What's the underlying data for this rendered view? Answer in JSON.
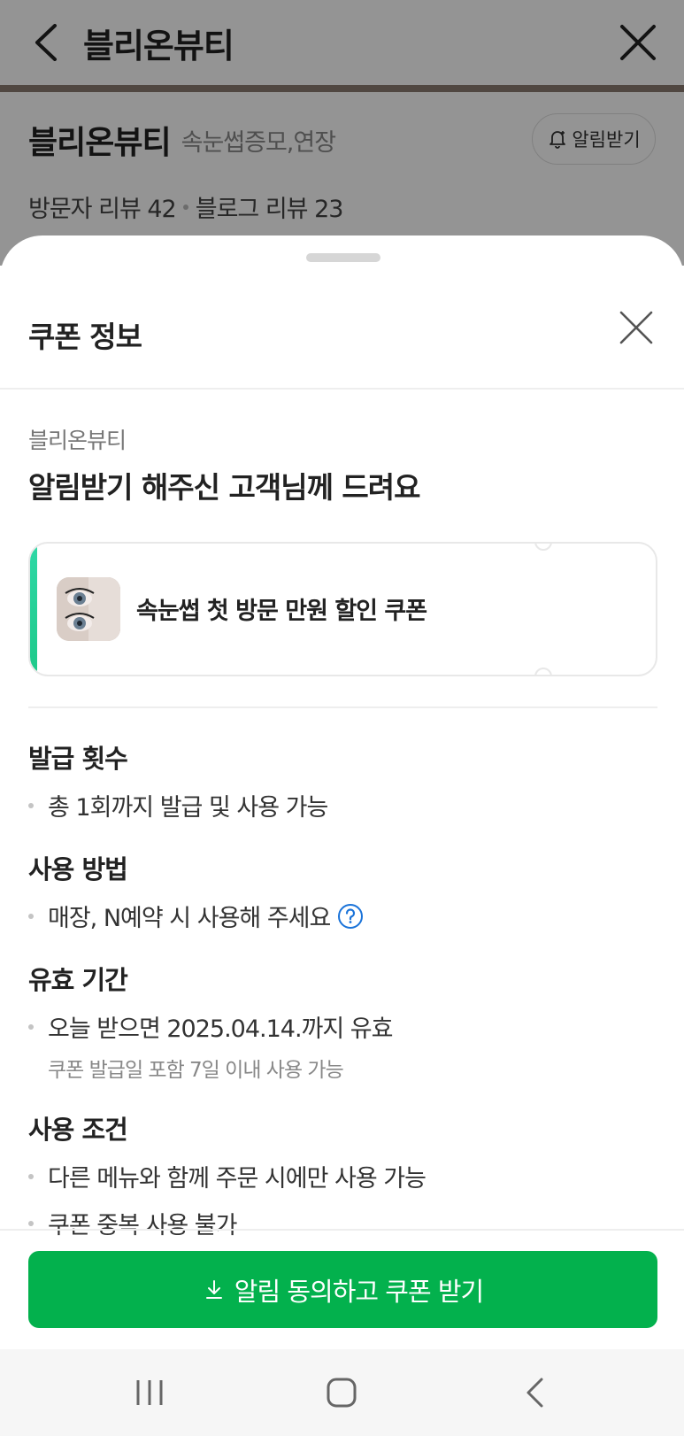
{
  "background_page": {
    "header_title": "블리온뷰티",
    "shop_name": "블리온뷰티",
    "category": "속눈썹증모,연장",
    "alarm_button_label": "알림받기",
    "visitor_reviews": "방문자 리뷰 42",
    "blog_reviews": "블로그 리뷰 23"
  },
  "sheet": {
    "title": "쿠폰 정보",
    "shop_name": "블리온뷰티",
    "headline": "알림받기 해주신 고객님께 드려요",
    "coupon": {
      "title": "속눈썹 첫 방문 만원 할인 쿠폰",
      "accent_color": "#1ec98a"
    },
    "sections": {
      "issue": {
        "title": "발급 횟수",
        "item": "총 1회까지 발급 및 사용 가능"
      },
      "usage": {
        "title": "사용 방법",
        "item": "매장, N예약 시 사용해 주세요"
      },
      "validity": {
        "title": "유효 기간",
        "item": "오늘 받으면 2025.04.14.까지 유효",
        "note": "쿠폰 발급일 포함 7일 이내 사용 가능"
      },
      "conditions": {
        "title": "사용 조건",
        "items": [
          "다른 메뉴와 함께 주문 시에만 사용 가능",
          "쿠폰 중복 사용 불가"
        ]
      }
    },
    "cta_label": "알림 동의하고 쿠폰 받기",
    "cta_color": "#03b14d"
  },
  "icons": [
    "back-icon",
    "close-icon",
    "bell-icon",
    "help-icon",
    "download-icon",
    "recent-apps-icon",
    "home-icon",
    "nav-back-icon"
  ]
}
